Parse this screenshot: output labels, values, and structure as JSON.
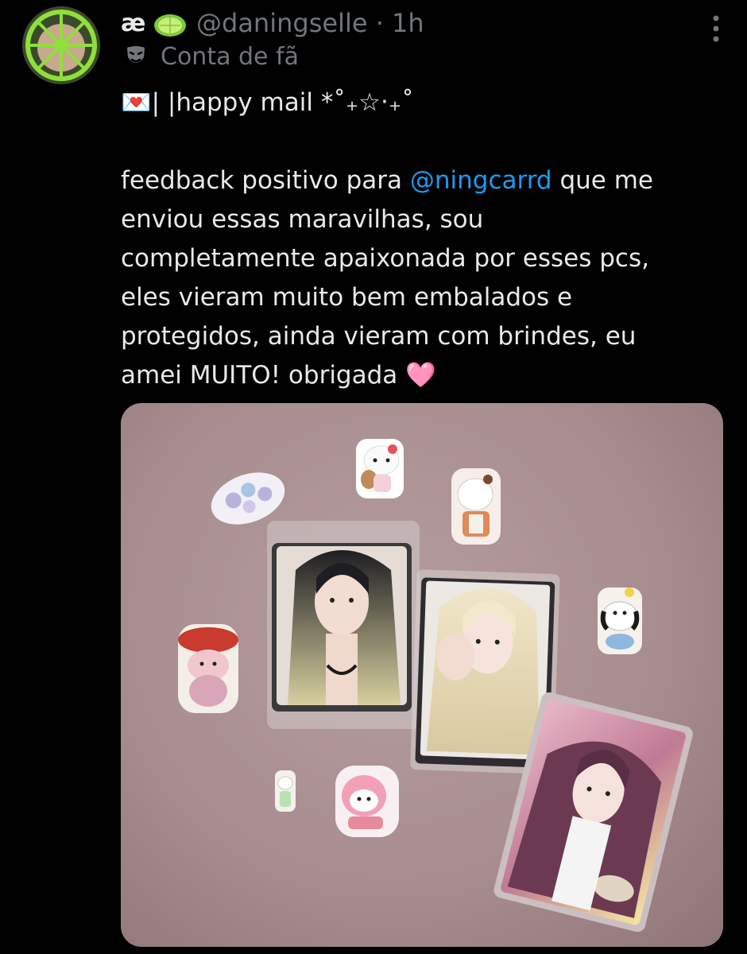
{
  "author": {
    "display_name": "æ",
    "name_emoji": "lime-emoji",
    "handle": "@daningselle",
    "separator": "·",
    "time": "1h",
    "label_icon": "theater-mask-icon",
    "label": "Conta de fã"
  },
  "tweet": {
    "line1_prefix": "💌| |happy mail",
    "line1_suffix": " *˚₊☆‧₊˚",
    "line2_before": "feedback positivo para ",
    "mention": "@ningcarrd",
    "line2_after": " que me",
    "line3": "enviou essas maravilhas, sou",
    "line4": "completamente apaixonada por esses pcs,",
    "line5": "eles vieram muito bem embalados e",
    "line6": "protegidos, ainda vieram com brindes, eu",
    "line7": "amei MUITO! obrigada",
    "end_emoji": "🩷"
  },
  "colors": {
    "background": "#000000",
    "text": "#e7e9ea",
    "secondary": "#71767b",
    "link": "#1d9bf0"
  }
}
